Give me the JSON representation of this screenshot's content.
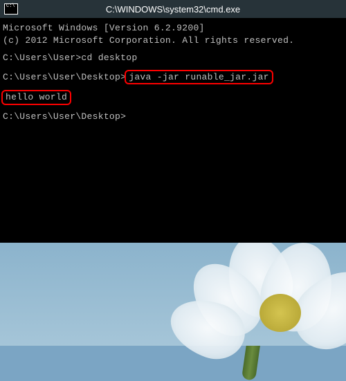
{
  "window": {
    "title": "C:\\WINDOWS\\system32\\cmd.exe",
    "icon_text": "C:\\"
  },
  "terminal": {
    "header_line1": "Microsoft Windows [Version 6.2.9200]",
    "header_line2": "(c) 2012 Microsoft Corporation. All rights reserved.",
    "prompt1": "C:\\Users\\User>",
    "command1": "cd desktop",
    "prompt2": "C:\\Users\\User\\Desktop>",
    "command2": "java -jar runable_jar.jar",
    "output1": "hello world",
    "prompt3": "C:\\Users\\User\\Desktop>"
  }
}
